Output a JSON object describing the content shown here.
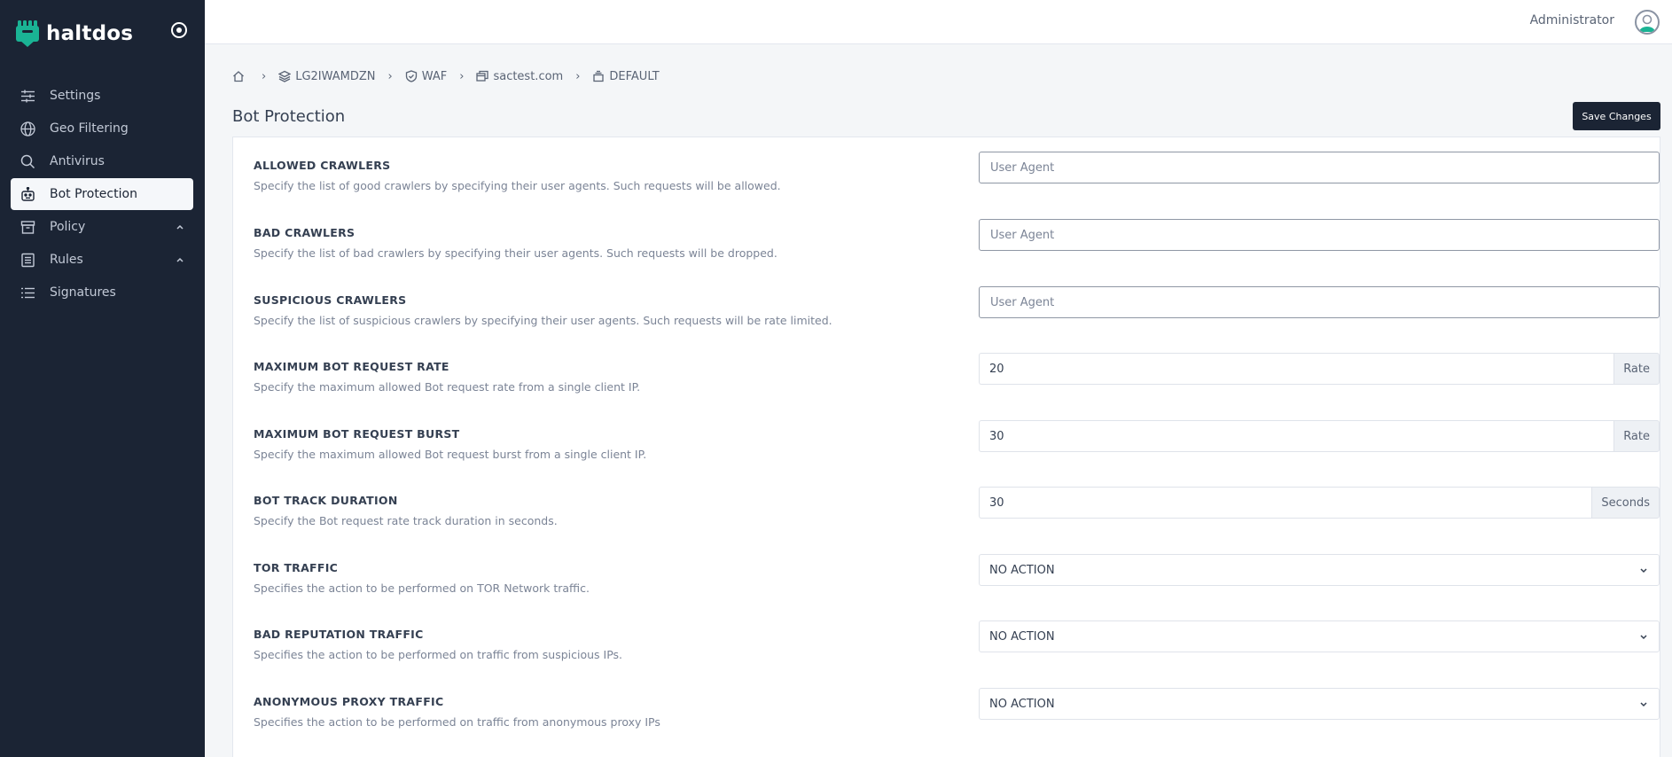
{
  "brand": {
    "name": "haltdos"
  },
  "sidebar": {
    "items": [
      {
        "label": "Settings",
        "icon": "sliders-icon"
      },
      {
        "label": "Geo Filtering",
        "icon": "globe-icon"
      },
      {
        "label": "Antivirus",
        "icon": "search-icon"
      },
      {
        "label": "Bot Protection",
        "icon": "robot-icon",
        "active": true
      },
      {
        "label": "Policy",
        "icon": "archive-icon",
        "expandable": true
      },
      {
        "label": "Rules",
        "icon": "list-box-icon",
        "expandable": true
      },
      {
        "label": "Signatures",
        "icon": "list-icon"
      }
    ]
  },
  "header": {
    "user": "Administrator"
  },
  "breadcrumb": [
    "LG2IWAMDZN",
    "WAF",
    "sactest.com",
    "DEFAULT"
  ],
  "page": {
    "title": "Bot Protection",
    "save_label": "Save Changes"
  },
  "settings": [
    {
      "label": "ALLOWED CRAWLERS",
      "desc": "Specify the list of good crawlers by specifying their user agents. Such requests will be allowed.",
      "placeholder": "User Agent"
    },
    {
      "label": "BAD CRAWLERS",
      "desc": "Specify the list of bad crawlers by specifying their user agents. Such requests will be dropped.",
      "placeholder": "User Agent"
    },
    {
      "label": "SUSPICIOUS CRAWLERS",
      "desc": "Specify the list of suspicious crawlers by specifying their user agents. Such requests will be rate limited.",
      "placeholder": "User Agent"
    },
    {
      "label": "MAXIMUM BOT REQUEST RATE",
      "desc": "Specify the maximum allowed Bot request rate from a single client IP.",
      "value": "20",
      "unit": "Rate"
    },
    {
      "label": "MAXIMUM BOT REQUEST BURST",
      "desc": "Specify the maximum allowed Bot request burst from a single client IP.",
      "value": "30",
      "unit": "Rate"
    },
    {
      "label": "BOT TRACK DURATION",
      "desc": "Specify the Bot request rate track duration in seconds.",
      "value": "30",
      "unit": "Seconds"
    },
    {
      "label": "TOR TRAFFIC",
      "desc": "Specifies the action to be performed on TOR Network traffic.",
      "selected": "NO ACTION"
    },
    {
      "label": "BAD REPUTATION TRAFFIC",
      "desc": "Specifies the action to be performed on traffic from suspicious IPs.",
      "selected": "NO ACTION"
    },
    {
      "label": "ANONYMOUS PROXY TRAFFIC",
      "desc": "Specifies the action to be performed on traffic from anonymous proxy IPs",
      "selected": "NO ACTION"
    }
  ],
  "colors": {
    "sidebar_bg": "#1b2434",
    "accent": "#1ab394",
    "button_bg": "#1b2434"
  }
}
